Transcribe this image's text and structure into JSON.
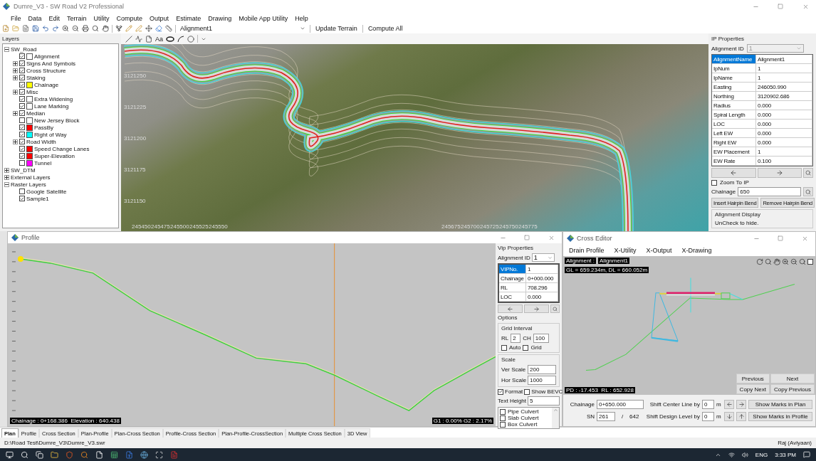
{
  "window": {
    "title": "Dumre_V3 - SW Road V2 Professional"
  },
  "menu": [
    "File",
    "Data",
    "Edit",
    "Terrain",
    "Utility",
    "Compute",
    "Output",
    "Estimate",
    "Drawing",
    "Mobile App Utility",
    "Help"
  ],
  "toolbar": {
    "alignment": "Alignment1",
    "buttons": [
      "Update Terrain",
      "Compute All"
    ]
  },
  "layers": {
    "title": "Layers",
    "tree": [
      {
        "label": "SW_Road",
        "expanded": true,
        "children": [
          {
            "label": "Alignment",
            "checked": true,
            "color": "#ffffff"
          },
          {
            "label": "Signs And Symbols",
            "checked": true,
            "expanded": false
          },
          {
            "label": "Cross Structure",
            "checked": true,
            "expanded": false
          },
          {
            "label": "Staking",
            "checked": true,
            "expanded": false
          },
          {
            "label": "Chainage",
            "checked": true,
            "color": "#ffff00"
          },
          {
            "label": "Misc",
            "checked": true,
            "expanded": false
          },
          {
            "label": "Extra Widening",
            "checked": true,
            "color": "#ffffff"
          },
          {
            "label": "Lane Marking",
            "checked": true,
            "color": "#ffffff"
          },
          {
            "label": "Median",
            "checked": true,
            "expanded": false
          },
          {
            "label": "New Jersey Block",
            "checked": false,
            "color": "#ffffff"
          },
          {
            "label": "PassBy",
            "checked": true,
            "color": "#ff0000"
          },
          {
            "label": "Right of Way",
            "checked": true,
            "color": "#00ffff"
          },
          {
            "label": "Road Width",
            "checked": true,
            "expanded": false
          },
          {
            "label": "Speed Change Lanes",
            "checked": true,
            "color": "#ff0000"
          },
          {
            "label": "Super-Elevation",
            "checked": true,
            "color": "#ff0000"
          },
          {
            "label": "Tunnel",
            "checked": false,
            "color": "#ff00ff"
          }
        ]
      },
      {
        "label": "SW_DTM",
        "expanded": false
      },
      {
        "label": "External Layers",
        "expanded": false
      },
      {
        "label": "Raster Layers",
        "expanded": true,
        "children": [
          {
            "label": "Google Satellite",
            "checked": false
          },
          {
            "label": "Sample1",
            "checked": true
          }
        ]
      }
    ]
  },
  "drawing_toolbar": {
    "text_tool": "Aa"
  },
  "map": {
    "y_labels": [
      "3121250",
      "3121225",
      "3121200",
      "3121175",
      "3121150"
    ],
    "x_labels": [
      "245450",
      "245475",
      "245500",
      "245525",
      "245550",
      "245675",
      "245700",
      "245725",
      "245750",
      "245775"
    ]
  },
  "ip_properties": {
    "title": "IP Properties",
    "alignment_id": {
      "label": "Alignment ID",
      "value": "1",
      "disabled": true
    },
    "rows": [
      {
        "name": "AlignmentName",
        "value": "Alignment1",
        "selected": true
      },
      {
        "name": "IpNum",
        "value": "1",
        "selected": false
      },
      {
        "name": "IpName",
        "value": "1",
        "selected": false
      },
      {
        "name": "Easting",
        "value": "246050.990",
        "selected": false
      },
      {
        "name": "Northing",
        "value": "3120902.686",
        "selected": false
      },
      {
        "name": "Radius",
        "value": "0.000",
        "selected": false
      },
      {
        "name": "Spiral Length",
        "value": "0.000",
        "selected": false
      },
      {
        "name": "LOC",
        "value": "0.000",
        "selected": false
      },
      {
        "name": "Left EW",
        "value": "0.000",
        "selected": false
      },
      {
        "name": "Right EW",
        "value": "0.000",
        "selected": false
      },
      {
        "name": "EW Placement",
        "value": "1",
        "selected": false
      },
      {
        "name": "EW Rate",
        "value": "0.100",
        "selected": false
      }
    ],
    "zoom_to_ip": {
      "label": "Zoom To IP",
      "checked": false
    },
    "chainage": {
      "label": "Chainage",
      "value": "650"
    },
    "buttons": [
      "Insert Hairpin Bend",
      "Remove Hairpin Bend"
    ],
    "display": {
      "title": "Alignment Display",
      "hint": "UnCheck to hide."
    }
  },
  "profile": {
    "title": "Profile",
    "readout": "Chainage : 0+168.386  Elevation : 640.438",
    "grades": "G1 : 0.00% G2 : 2.17%",
    "vip": {
      "title": "Vip Properties",
      "alignment_id": {
        "label": "Alignment ID",
        "value": "1"
      },
      "rows": [
        {
          "name": "VIPNo.",
          "value": "1",
          "selected": true
        },
        {
          "name": "Chainage",
          "value": "0+000.000",
          "selected": false
        },
        {
          "name": "RL",
          "value": "708.296",
          "selected": false
        },
        {
          "name": "LOC",
          "value": "0.000",
          "selected": false
        }
      ],
      "options": {
        "title": "Options",
        "grid": {
          "title": "Grid Interval",
          "rl_label": "RL",
          "rl": "2",
          "ch_label": "CH",
          "ch": "100",
          "toggles": [
            {
              "label": "Auto",
              "checked": false
            },
            {
              "label": "Grid",
              "checked": false
            }
          ]
        },
        "scale": {
          "title": "Scale",
          "fields": [
            {
              "label": "Ver Scale",
              "value": "200"
            },
            {
              "label": "Hor Scale",
              "value": "1000"
            }
          ]
        },
        "toggles": [
          {
            "label": "Format",
            "checked": true
          },
          {
            "label": "Show BEVC",
            "checked": false
          }
        ],
        "text_height": {
          "label": "Text Height",
          "value": "5"
        }
      },
      "culverts": [
        {
          "label": "Pipe Culvert",
          "checked": false
        },
        {
          "label": "Slab Culvert",
          "checked": false
        },
        {
          "label": "Box Culvert",
          "checked": false
        }
      ]
    }
  },
  "cross_editor": {
    "title": "Cross Editor",
    "menu": [
      "Drain Profile",
      "X-Utility",
      "X-Output",
      "X-Drawing"
    ],
    "alignment_label": "Alignment :",
    "alignment": "Alignment1",
    "levels": "GL = 659.234m, DL = 660.052m",
    "cursor": "PD : -17.453  RL : 652.928",
    "nav_buttons": [
      "Previous",
      "Next",
      "Copy Next",
      "Copy Previous"
    ],
    "fit_checkbox": {
      "checked": false
    },
    "form": {
      "chainage": {
        "label": "Chainage",
        "value": "0+650.000"
      },
      "sn": {
        "label": "SN",
        "value": "261",
        "separator": "/",
        "total": "642"
      },
      "shift_center": {
        "label": "Shift Center Line by",
        "value": "0",
        "unit": "m"
      },
      "shift_design": {
        "label": "Shift Design Level by",
        "value": "0",
        "unit": "m"
      },
      "buttons": [
        "Show Marks in Plan",
        "Show Marks in Profile"
      ]
    }
  },
  "view_tabs": [
    {
      "label": "Plan",
      "selected": true
    },
    {
      "label": "Profile",
      "selected": false
    },
    {
      "label": "Cross Section",
      "selected": false
    },
    {
      "label": "Plan-Profile",
      "selected": false
    },
    {
      "label": "Plan-Cross Section",
      "selected": false
    },
    {
      "label": "Profile-Cross Section",
      "selected": false
    },
    {
      "label": "Plan-Profile-CrossSection",
      "selected": false
    },
    {
      "label": "Multiple Cross Section",
      "selected": false
    },
    {
      "label": "3D View",
      "selected": false
    }
  ],
  "status_bar": {
    "path": "D:\\Road Test\\Dumre_V3\\Dumre_V3.swr",
    "user": "Raj (Aviyaan)"
  },
  "taskbar": {
    "language": "ENG",
    "time": "3:33 PM"
  }
}
